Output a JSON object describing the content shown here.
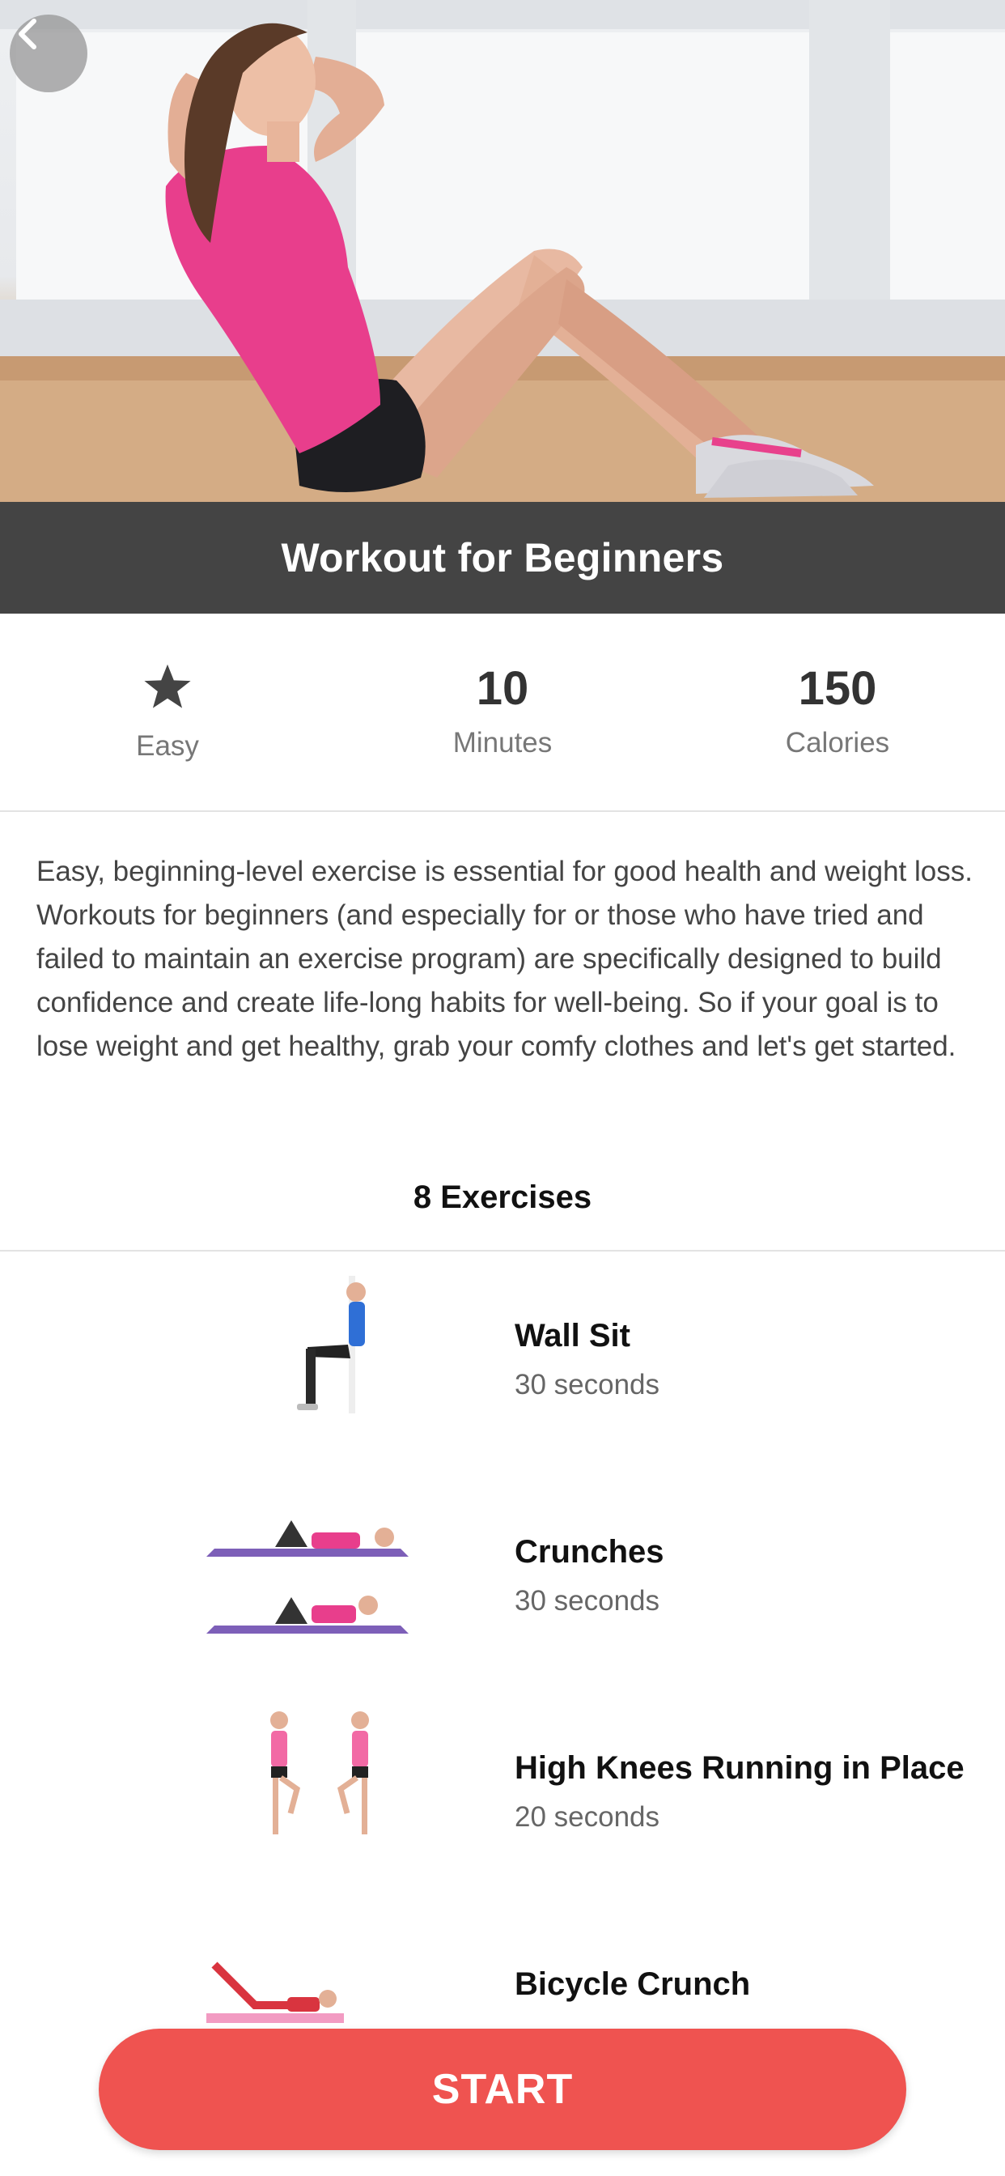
{
  "header": {
    "title": "Workout for Beginners",
    "back_icon": "chevron-left-icon"
  },
  "stats": [
    {
      "icon": "star-icon",
      "value": "",
      "label": "Easy"
    },
    {
      "value": "10",
      "label": "Minutes"
    },
    {
      "value": "150",
      "label": "Calories"
    }
  ],
  "description": "Easy, beginning-level exercise is essential for good health and weight loss. Workouts for beginners (and especially for or those who have tried and failed to maintain an exercise program) are specifically designed to build confidence and create life-long habits for well-being. So if your goal is to lose weight and get healthy, grab your comfy clothes and let's get started.",
  "exercises_label": "8 Exercises",
  "exercises": [
    {
      "name": "Wall Sit",
      "duration": "30 seconds"
    },
    {
      "name": "Crunches",
      "duration": "30 seconds"
    },
    {
      "name": "High Knees Running in Place",
      "duration": "20 seconds"
    },
    {
      "name": "Bicycle Crunch",
      "duration": ""
    }
  ],
  "start_label": "START",
  "colors": {
    "accent": "#ef5350",
    "title_bar": "#444444",
    "shirt": "#e83e8c"
  }
}
